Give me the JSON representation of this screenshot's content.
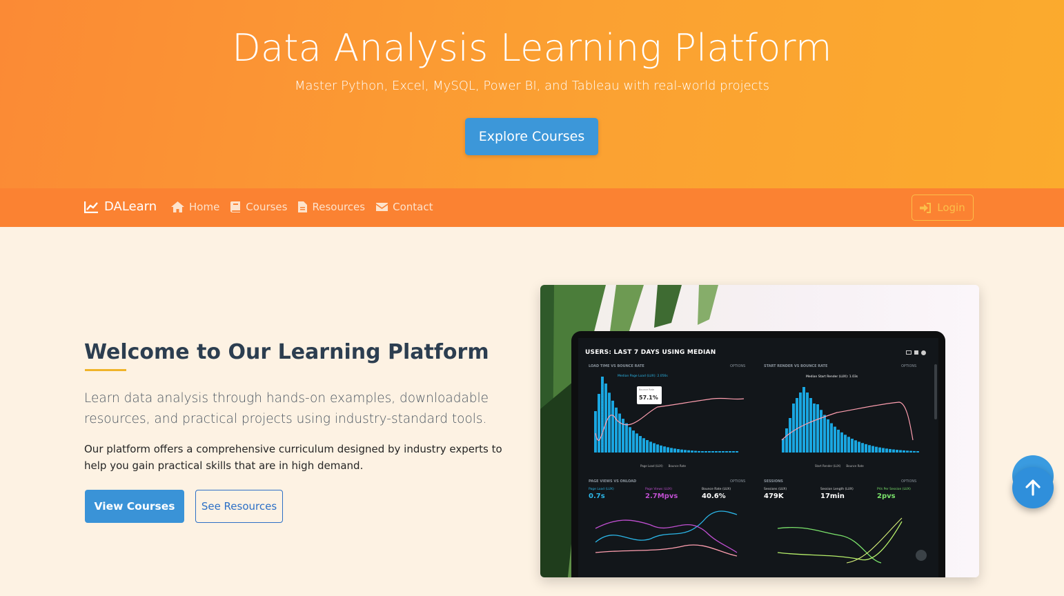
{
  "hero": {
    "title": "Data Analysis Learning Platform",
    "subtitle": "Master Python, Excel, MySQL, Power BI, and Tableau with real-world projects",
    "cta_label": "Explore Courses"
  },
  "navbar": {
    "brand": "DALearn",
    "items": [
      {
        "label": "Home",
        "icon": "home-icon"
      },
      {
        "label": "Courses",
        "icon": "book-icon"
      },
      {
        "label": "Resources",
        "icon": "file-icon"
      },
      {
        "label": "Contact",
        "icon": "envelope-icon"
      }
    ],
    "login_label": "Login"
  },
  "welcome": {
    "title": "Welcome to Our Learning Platform",
    "lead": "Learn data analysis through hands-on examples, downloadable resources, and practical projects using industry-standard tools.",
    "body": "Our platform offers a comprehensive curriculum designed by industry experts to help you gain practical skills that are in high demand.",
    "primary_button": "View Courses",
    "secondary_button": "See Resources"
  },
  "dashboard_photo": {
    "header": "USERS: LAST 7 DAYS USING MEDIAN",
    "panel1_title": "LOAD TIME VS BOUNCE RATE",
    "panel1_legend": "Median Page Load (LUX): 2.056s",
    "tooltip_label": "Bounce Rate",
    "tooltip_value": "57.1%",
    "panel1_footer": [
      "Page Load (LUX)",
      "Bounce Rate"
    ],
    "panel2_title": "START RENDER VS BOUNCE RATE",
    "panel2_legend": "Median Start Render (LUX): 1.03s",
    "panel2_footer": [
      "Start Render (LUX)",
      "Bounce Rate"
    ],
    "options": "OPTIONS",
    "panel3_title": "PAGE VIEWS VS ONLOAD",
    "panel4_title": "SESSIONS",
    "metrics": [
      {
        "label": "Page Load (LUX)",
        "value": "0.7s",
        "color": "#2bb6e8"
      },
      {
        "label": "Page Views (LUX)",
        "value": "2.7Mpvs",
        "color": "#c04fd1"
      },
      {
        "label": "Bounce Rate (LUX)",
        "value": "40.6%",
        "color": "#ffffff"
      },
      {
        "label": "Sessions (LUX)",
        "value": "479K",
        "color": "#ffffff"
      },
      {
        "label": "Session Length (LUX)",
        "value": "17min",
        "color": "#ffffff"
      },
      {
        "label": "PVs Per Session (LUX)",
        "value": "2pvs",
        "color": "#7be36b"
      }
    ]
  },
  "colors": {
    "accent": "#fb8232",
    "primary_blue": "#3a93d7",
    "underline": "#f0b429"
  }
}
